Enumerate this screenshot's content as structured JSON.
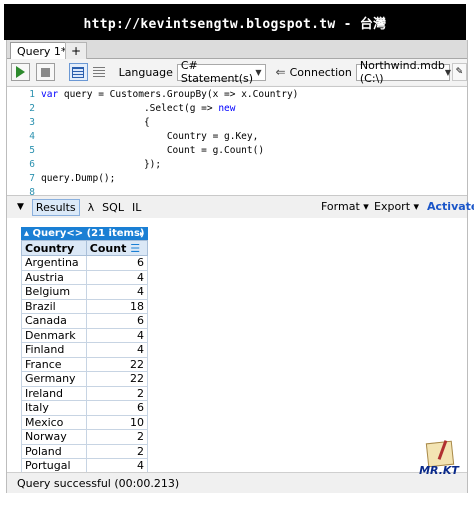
{
  "banner": {
    "text": "http://kevintsengtw.blogspot.tw - 台灣"
  },
  "tabs": {
    "query_tab": "Query 1*",
    "add_tab": "+"
  },
  "toolbar": {
    "language_label": "Language",
    "language_value": "C# Statement(s)",
    "connection_label": "Connection",
    "connection_value": "Northwind.mdb (C:\\)"
  },
  "editor": {
    "line_numbers": [
      "1",
      "2",
      "3",
      "4",
      "5",
      "6",
      "7",
      "8"
    ],
    "l1_kw": "var",
    "l1_rest": " query = Customers.GroupBy(x => x.Country)",
    "l2_a": "                  .Select(g => ",
    "l2_kw": "new",
    "l3": "                  {",
    "l4": "                      Country = g.Key,",
    "l5": "                      Count = g.Count()",
    "l6": "                  });",
    "l7": "query.Dump();",
    "l8": ""
  },
  "results_bar": {
    "tabs": [
      "Results",
      "λ",
      "SQL",
      "IL"
    ],
    "format_label": "Format ▾",
    "export_label": "Export ▾",
    "activate_label": "Activate"
  },
  "query_header": {
    "title": "▴ Query<> (21 items)",
    "arrow": "▸"
  },
  "table": {
    "columns": [
      "Country",
      "Count"
    ],
    "rows": [
      [
        "Argentina",
        "6"
      ],
      [
        "Austria",
        "4"
      ],
      [
        "Belgium",
        "4"
      ],
      [
        "Brazil",
        "18"
      ],
      [
        "Canada",
        "6"
      ],
      [
        "Denmark",
        "4"
      ],
      [
        "Finland",
        "4"
      ],
      [
        "France",
        "22"
      ],
      [
        "Germany",
        "22"
      ],
      [
        "Ireland",
        "2"
      ],
      [
        "Italy",
        "6"
      ],
      [
        "Mexico",
        "10"
      ],
      [
        "Norway",
        "2"
      ],
      [
        "Poland",
        "2"
      ],
      [
        "Portugal",
        "4"
      ]
    ]
  },
  "status": {
    "text": "Query successful  (00:00.213)"
  },
  "logo": {
    "text": "MR.KT"
  },
  "colors": {
    "accent": "#1a7fd4",
    "keyword": "#0000ff",
    "line_number": "#2b91af",
    "header_bg": "#000000"
  }
}
